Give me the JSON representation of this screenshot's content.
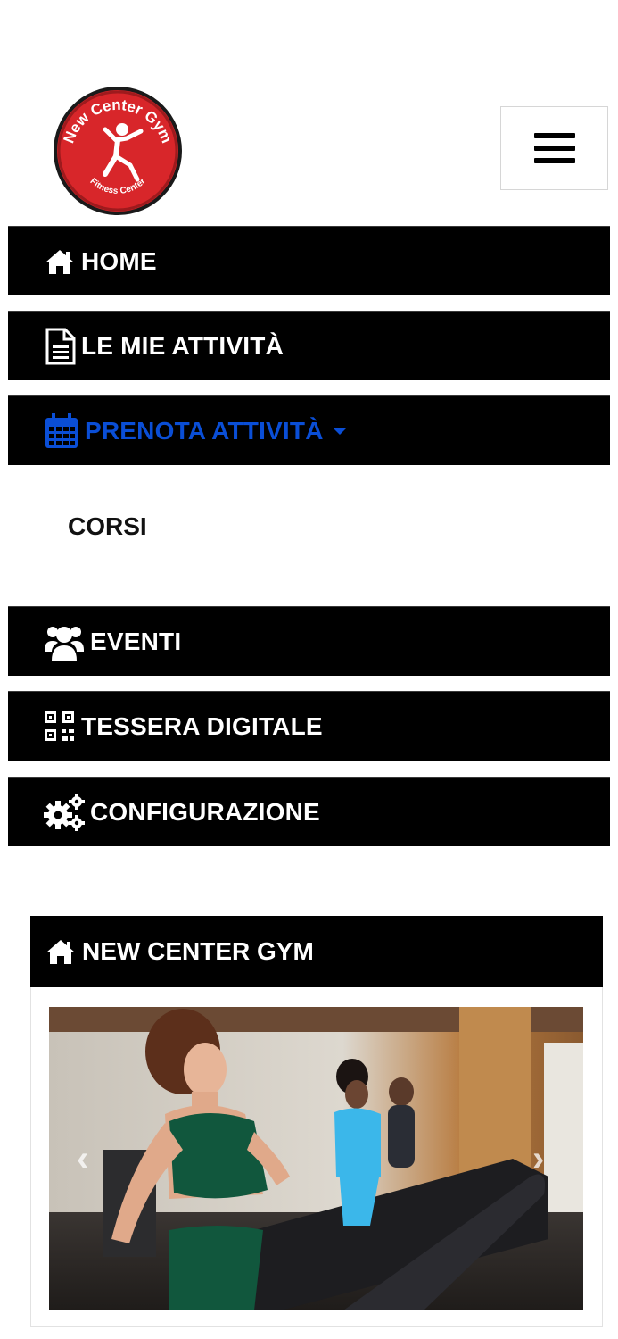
{
  "logo": {
    "top_text": "New Center Gym",
    "bottom_text": "Fitness Center"
  },
  "menu_toggle_icon": "hamburger-icon",
  "nav": [
    {
      "label": "HOME",
      "icon": "home-icon"
    },
    {
      "label": "LE MIE ATTIVITÀ",
      "icon": "document-icon"
    },
    {
      "label": "PRENOTA ATTIVITÀ",
      "icon": "calendar-icon",
      "active": true
    },
    {
      "label": "EVENTI",
      "icon": "users-icon"
    },
    {
      "label": "TESSERA DIGITALE",
      "icon": "qrcode-icon"
    },
    {
      "label": "CONFIGURAZIONE",
      "icon": "cogs-icon"
    }
  ],
  "submenu": {
    "corsi": "CORSI"
  },
  "card": {
    "title": "NEW CENTER GYM",
    "icon": "home-icon"
  },
  "carousel": {
    "prev_label": "‹",
    "next_label": "›"
  },
  "colors": {
    "nav_bg": "#000000",
    "active": "#0a4ed6",
    "logo_red": "#d8262a"
  }
}
